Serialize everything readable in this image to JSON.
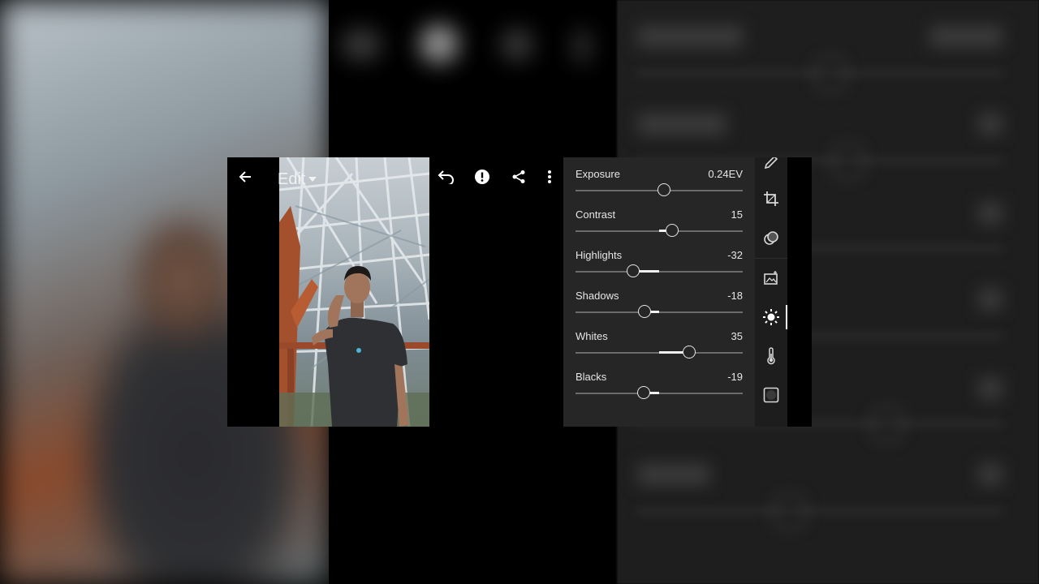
{
  "header": {
    "title": "Edit"
  },
  "icons": {
    "back": "arrow-left-icon",
    "dropdown": "caret-down-icon",
    "undo": "undo-icon",
    "alert": "alert-icon",
    "share": "share-icon",
    "more": "more-vertical-icon"
  },
  "light_panel": {
    "adjustments": [
      {
        "label": "Exposure",
        "value": "0.24EV",
        "level": 0.24,
        "min": -5,
        "max": 5
      },
      {
        "label": "Contrast",
        "value": "15",
        "level": 15,
        "min": -100,
        "max": 100
      },
      {
        "label": "Highlights",
        "value": "-32",
        "level": -32,
        "min": -100,
        "max": 100
      },
      {
        "label": "Shadows",
        "value": "-18",
        "level": -18,
        "min": -100,
        "max": 100
      },
      {
        "label": "Whites",
        "value": "35",
        "level": 35,
        "min": -100,
        "max": 100
      },
      {
        "label": "Blacks",
        "value": "-19",
        "level": -19,
        "min": -100,
        "max": 100
      }
    ]
  },
  "tools": [
    {
      "name": "brush-icon",
      "active": false
    },
    {
      "name": "crop-icon",
      "active": false
    },
    {
      "name": "healing-icon",
      "active": false
    },
    {
      "name": "auto-enhance-icon",
      "active": false
    },
    {
      "name": "light-icon",
      "active": true
    },
    {
      "name": "color-temperature-icon",
      "active": false
    },
    {
      "name": "vignette-icon",
      "active": false
    }
  ],
  "colors": {
    "panel_bg": "#262626",
    "toolstrip_bg": "#1d1d1d",
    "text": "#e6e6e6",
    "accent": "#ffffff"
  }
}
